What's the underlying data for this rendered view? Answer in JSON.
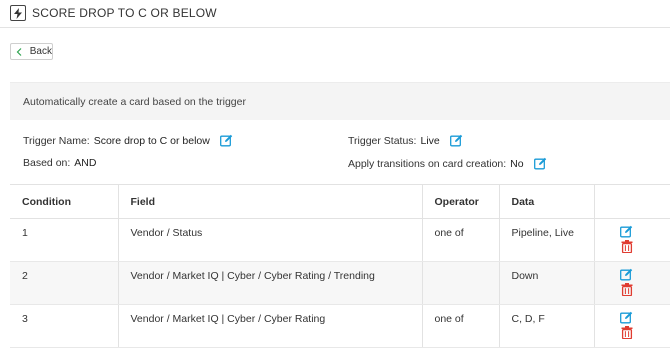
{
  "header": {
    "title": "SCORE DROP TO C OR BELOW",
    "icon": "lightning-bolt-icon"
  },
  "back_button": {
    "label": "Back"
  },
  "info": {
    "description": "Automatically create a card based on the trigger"
  },
  "trigger": {
    "name_label": "Trigger Name:",
    "name_value": "Score drop to C or below",
    "based_on_label": "Based on:",
    "based_on_value": "AND",
    "status_label": "Trigger Status:",
    "status_value": "Live",
    "apply_label": "Apply transitions on card creation:",
    "apply_value": "No"
  },
  "table": {
    "headers": [
      "Condition",
      "Field",
      "Operator",
      "Data",
      ""
    ],
    "rows": [
      {
        "condition": "1",
        "field": "Vendor / Status",
        "operator": "one of",
        "data": "Pipeline, Live"
      },
      {
        "condition": "2",
        "field": "Vendor / Market IQ | Cyber / Cyber Rating / Trending",
        "operator": "",
        "data": "Down"
      },
      {
        "condition": "3",
        "field": "Vendor / Market IQ | Cyber / Cyber Rating",
        "operator": "one of",
        "data": "C, D, F"
      }
    ]
  },
  "colors": {
    "edit_icon": "#1a9bd7",
    "delete_icon": "#e03c31"
  }
}
